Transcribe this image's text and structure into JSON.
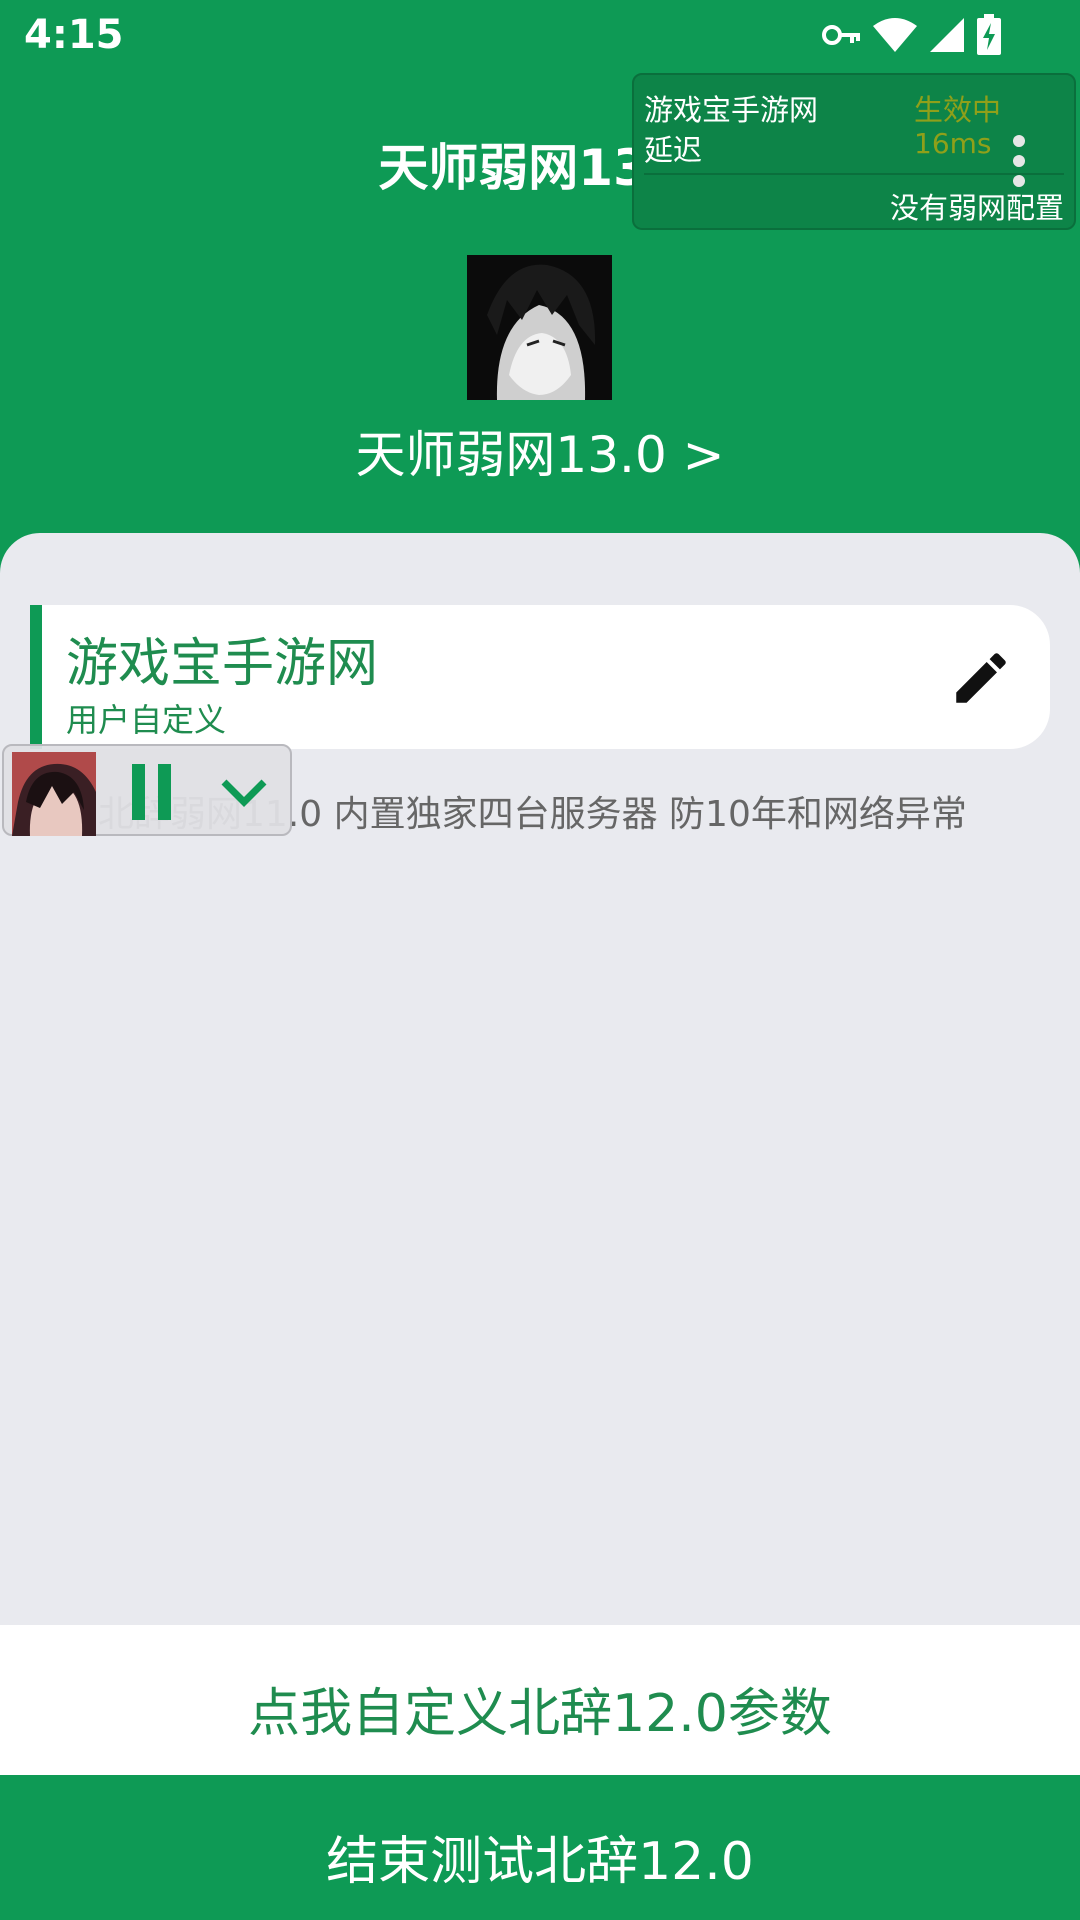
{
  "status_bar": {
    "time": "4:15",
    "icons": [
      "vpn-key-icon",
      "wifi-icon",
      "cell-signal-icon",
      "battery-charging-icon"
    ]
  },
  "header": {
    "title": "天师弱网13.0"
  },
  "floating_panel": {
    "name": "游戏宝手游网",
    "latency_label": "延迟",
    "status": "生效中",
    "latency_value": "16ms",
    "config_text": "没有弱网配置",
    "status_color": "#8fa01a"
  },
  "profile": {
    "name": "天师弱网13.0 >"
  },
  "card": {
    "title": "游戏宝手游网",
    "subtitle": "用户自定义",
    "edit_icon": "pencil-icon"
  },
  "description": "北辞弱网11.0 内置独家四台服务器 防10年和网络异常",
  "mini_player": {
    "pause_icon": "pause-icon",
    "collapse_icon": "chevron-down-icon"
  },
  "buttons": {
    "customize": "点我自定义北辞12.0参数",
    "end_test": "结束测试北辞12.0"
  },
  "colors": {
    "brand_green": "#0e9a55",
    "text_green": "#1f8c4f",
    "content_bg": "#e9eaef"
  }
}
